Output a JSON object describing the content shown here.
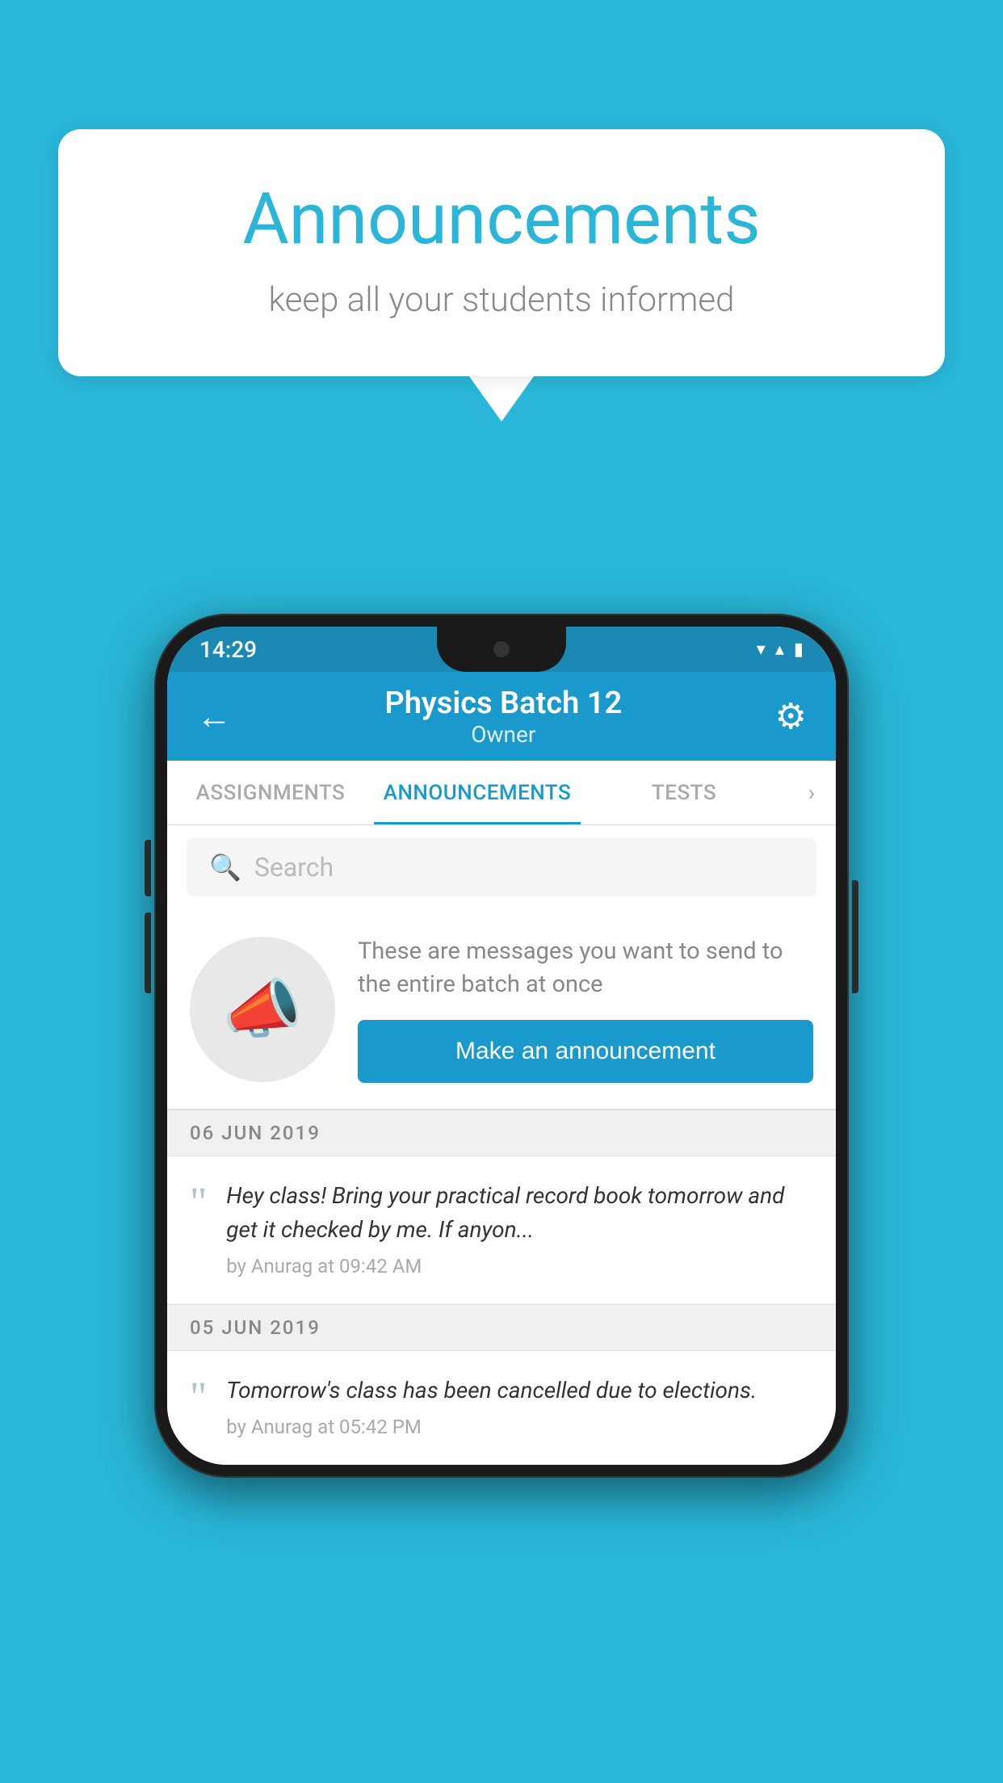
{
  "background_color": "#29b6d8",
  "speech_bubble": {
    "title": "Announcements",
    "subtitle": "keep all your students informed"
  },
  "phone": {
    "status_bar": {
      "time": "14:29",
      "wifi_icon": "▼",
      "signal_icon": "▲",
      "battery_icon": "▮"
    },
    "app_bar": {
      "back_label": "←",
      "title": "Physics Batch 12",
      "subtitle": "Owner",
      "settings_label": "⚙"
    },
    "tabs": [
      {
        "label": "ASSIGNMENTS",
        "active": false
      },
      {
        "label": "ANNOUNCEMENTS",
        "active": true
      },
      {
        "label": "TESTS",
        "active": false
      }
    ],
    "search": {
      "placeholder": "Search"
    },
    "promo": {
      "text": "These are messages you want to send to the entire batch at once",
      "button_label": "Make an announcement"
    },
    "announcements": [
      {
        "date": "06  JUN  2019",
        "text": "Hey class! Bring your practical record book tomorrow and get it checked by me. If anyon...",
        "meta": "by Anurag at 09:42 AM"
      },
      {
        "date": "05  JUN  2019",
        "text": "Tomorrow's class has been cancelled due to elections.",
        "meta": "by Anurag at 05:42 PM"
      }
    ]
  }
}
